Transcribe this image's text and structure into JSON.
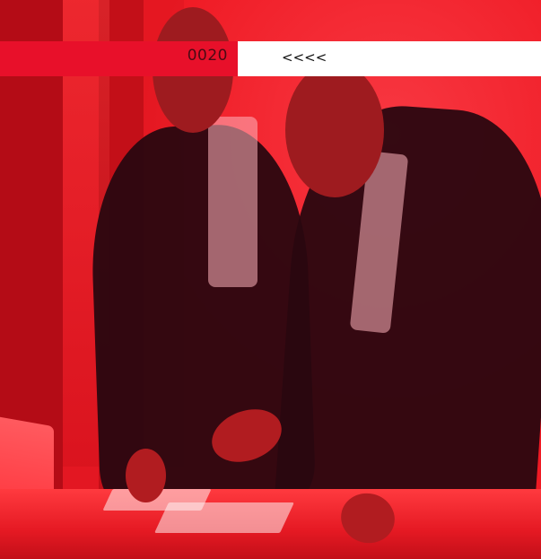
{
  "banner": {
    "counter": "0020",
    "arrows": "<<<<"
  },
  "colors": {
    "accent_red": "#e8102a",
    "banner_white": "#ffffff"
  },
  "icons": {
    "nav_arrows": "chevron-left-icon"
  }
}
